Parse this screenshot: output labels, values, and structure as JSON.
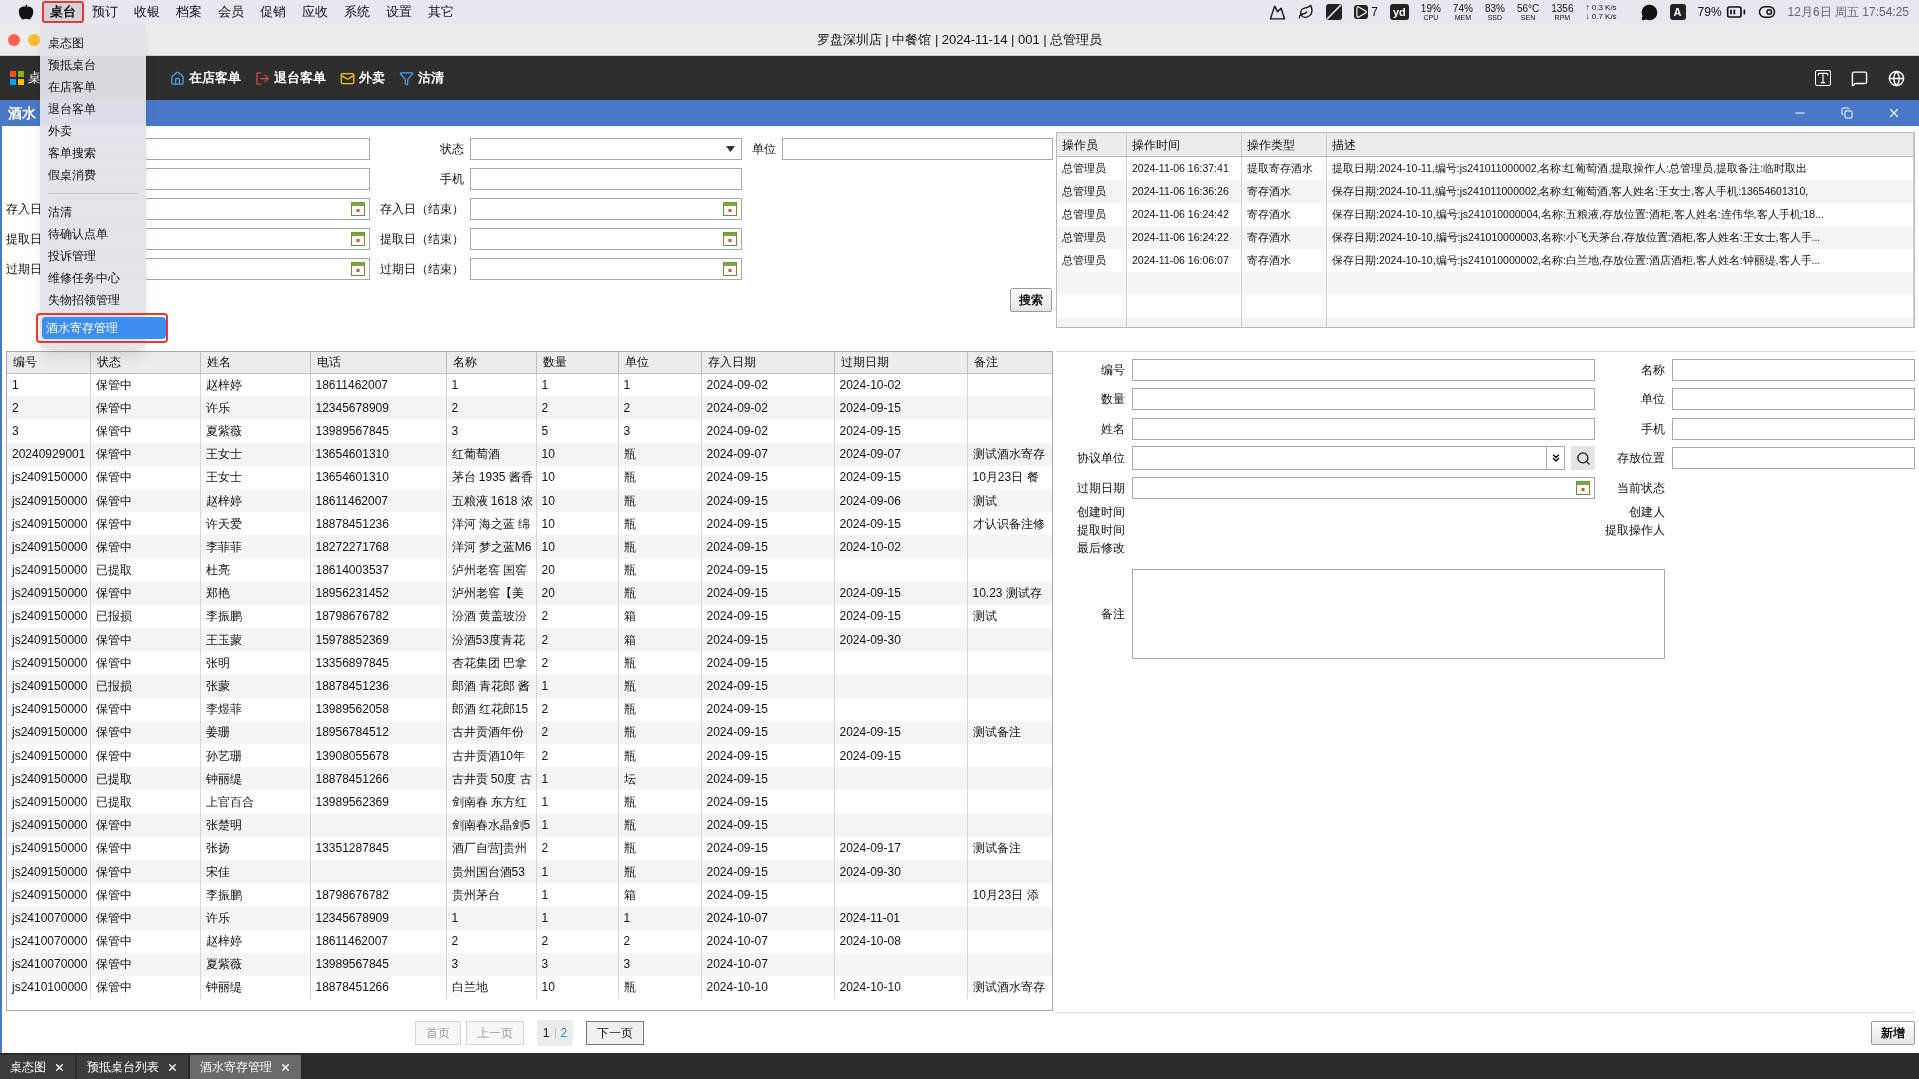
{
  "menubar": {
    "items": [
      {
        "label": "桌台",
        "selected": true,
        "annotated": true
      },
      {
        "label": "预订",
        "selected": false,
        "annotated": false
      },
      {
        "label": "收银",
        "selected": false,
        "annotated": false
      },
      {
        "label": "档案",
        "selected": false,
        "annotated": false
      },
      {
        "label": "会员",
        "selected": false,
        "annotated": false
      },
      {
        "label": "促销",
        "selected": false,
        "annotated": false
      },
      {
        "label": "应收",
        "selected": false,
        "annotated": false
      },
      {
        "label": "系统",
        "selected": false,
        "annotated": false
      },
      {
        "label": "设置",
        "selected": false,
        "annotated": false
      },
      {
        "label": "其它",
        "selected": false,
        "annotated": false
      }
    ],
    "badge_count": "7",
    "yd": "yd",
    "meters": [
      {
        "value": "19%",
        "caption": "CPU"
      },
      {
        "value": "74%",
        "caption": "MEM"
      },
      {
        "value": "83%",
        "caption": "SSD"
      },
      {
        "value": "56°C",
        "caption": "SEN"
      },
      {
        "value": "1356",
        "caption": "RPM"
      }
    ],
    "network": [
      "↑ 0.3 K/s",
      "↓ 0.7 K/s"
    ],
    "input_source": "A",
    "battery": "79%",
    "clock": "12月6日 周五 17:54:25"
  },
  "window": {
    "title": "罗盘深圳店 | 中餐馆 | 2024-11-14 | 001 | 总管理员"
  },
  "toolbar": {
    "home": "桌",
    "items": [
      {
        "label": "在店客单",
        "kind": "checkin"
      },
      {
        "label": "退台客单",
        "kind": "checkout"
      },
      {
        "label": "外卖",
        "kind": "takeout"
      },
      {
        "label": "沽清",
        "kind": "filter"
      }
    ]
  },
  "dropdown": {
    "items": [
      {
        "kind": "item",
        "label": "桌态图",
        "selected": false,
        "annotated": false
      },
      {
        "kind": "item",
        "label": "预抵桌台",
        "selected": false,
        "annotated": false
      },
      {
        "kind": "item",
        "label": "在店客单",
        "selected": false,
        "annotated": false
      },
      {
        "kind": "item",
        "label": "退台客单",
        "selected": false,
        "annotated": false
      },
      {
        "kind": "item",
        "label": "外卖",
        "selected": false,
        "annotated": false
      },
      {
        "kind": "item",
        "label": "客单搜索",
        "selected": false,
        "annotated": false
      },
      {
        "kind": "item",
        "label": "假桌消费",
        "selected": false,
        "annotated": false
      },
      {
        "kind": "separator"
      },
      {
        "kind": "item",
        "label": "沽清",
        "selected": false,
        "annotated": false
      },
      {
        "kind": "item",
        "label": "待确认点单",
        "selected": false,
        "annotated": false
      },
      {
        "kind": "item",
        "label": "投诉管理",
        "selected": false,
        "annotated": false
      },
      {
        "kind": "item",
        "label": "维修任务中心",
        "selected": false,
        "annotated": false
      },
      {
        "kind": "item",
        "label": "失物招领管理",
        "selected": false,
        "annotated": false
      },
      {
        "kind": "item",
        "label": "酒水寄存管理",
        "selected": true,
        "annotated": true
      }
    ]
  },
  "panel": {
    "title": "酒水"
  },
  "filters": [
    {
      "fields": [
        {
          "kind": "text"
        },
        {
          "label": "状态",
          "kind": "select"
        },
        {
          "label": "单位",
          "kind": "text"
        }
      ]
    },
    {
      "fields": [
        {
          "kind": "text"
        },
        {
          "label": "手机",
          "kind": "text"
        }
      ]
    },
    {
      "fields": [
        {
          "label": "存入日",
          "kind": "date"
        },
        {
          "label": "存入日（结束）",
          "kind": "date"
        }
      ]
    },
    {
      "fields": [
        {
          "label": "提取日",
          "kind": "date"
        },
        {
          "label": "提取日（结束）",
          "kind": "date"
        }
      ]
    },
    {
      "fields": [
        {
          "label": "过期日",
          "kind": "date"
        },
        {
          "label": "过期日（结束）",
          "kind": "date"
        }
      ]
    }
  ],
  "search_button": "搜索",
  "log": {
    "columns": [
      "操作员",
      "操作时间",
      "操作类型",
      "描述"
    ],
    "rows": [
      {
        "operator": "总管理员",
        "time": "2024-11-06 16:37:41",
        "type": "提取寄存酒水",
        "description": "提取日期:2024-10-11,编号:js241011000002,名称:红葡萄酒,提取操作人:总管理员,提取备注:临时取出"
      },
      {
        "operator": "总管理员",
        "time": "2024-11-06 16:36:26",
        "type": "寄存酒水",
        "description": "保存日期:2024-10-11,编号:js241011000002,名称:红葡萄酒,客人姓名:王女士,客人手机:13654601310,"
      },
      {
        "operator": "总管理员",
        "time": "2024-11-06 16:24:42",
        "type": "寄存酒水",
        "description": "保存日期:2024-10-10,编号:js241010000004,名称:五粮液,存放位置:酒柜,客人姓名:连伟华,客人手机:18..."
      },
      {
        "operator": "总管理员",
        "time": "2024-11-06 16:24:22",
        "type": "寄存酒水",
        "description": "保存日期:2024-10-10,编号:js241010000003,名称:小飞天茅台,存放位置:酒柜,客人姓名:王女士,客人手..."
      },
      {
        "operator": "总管理员",
        "time": "2024-11-06 16:06:07",
        "type": "寄存酒水",
        "description": "保存日期:2024-10-10,编号:js241010000002,名称:白兰地,存放位置:酒店酒柜,客人姓名:钟丽缇,客人手..."
      }
    ]
  },
  "table": {
    "columns": [
      "编号",
      "状态",
      "姓名",
      "电话",
      "名称",
      "数量",
      "单位",
      "存入日期",
      "过期日期",
      "备注"
    ],
    "rows": [
      {
        "id": "1",
        "status": "保管中",
        "name": "赵梓婷",
        "phone": "18611462007",
        "item": "1",
        "qty": "1",
        "unit": "1",
        "stored": "2024-09-02",
        "expires": "2024-10-02"
      },
      {
        "id": "2",
        "status": "保管中",
        "name": "许乐",
        "phone": "12345678909",
        "item": "2",
        "qty": "2",
        "unit": "2",
        "stored": "2024-09-02",
        "expires": "2024-09-15"
      },
      {
        "id": "3",
        "status": "保管中",
        "name": "夏紫薇",
        "phone": "13989567845",
        "item": "3",
        "qty": "5",
        "unit": "3",
        "stored": "2024-09-02",
        "expires": "2024-09-15"
      },
      {
        "id": "20240929001",
        "status": "保管中",
        "name": "王女士",
        "phone": "13654601310",
        "item": "红葡萄酒",
        "qty": "10",
        "unit": "瓶",
        "stored": "2024-09-07",
        "expires": "2024-09-07",
        "note": "测试酒水寄存"
      },
      {
        "id": "js2409150000",
        "status": "保管中",
        "name": "王女士",
        "phone": "13654601310",
        "item": "茅台 1935 酱香",
        "qty": "10",
        "unit": "瓶",
        "stored": "2024-09-15",
        "expires": "2024-09-15",
        "note": "10月23日 餐"
      },
      {
        "id": "js2409150000",
        "status": "保管中",
        "name": "赵梓婷",
        "phone": "18611462007",
        "item": "五粮液 1618 浓",
        "qty": "10",
        "unit": "瓶",
        "stored": "2024-09-15",
        "expires": "2024-09-06",
        "note": "测试"
      },
      {
        "id": "js2409150000",
        "status": "保管中",
        "name": "许天爱",
        "phone": "18878451236",
        "item": "洋河 海之蓝 绵",
        "qty": "10",
        "unit": "瓶",
        "stored": "2024-09-15",
        "expires": "2024-09-15",
        "note": "才认识备注修"
      },
      {
        "id": "js2409150000",
        "status": "保管中",
        "name": "李菲菲",
        "phone": "18272271768",
        "item": "洋河 梦之蓝M6",
        "qty": "10",
        "unit": "瓶",
        "stored": "2024-09-15",
        "expires": "2024-10-02"
      },
      {
        "id": "js2409150000",
        "status": "已提取",
        "name": "杜亮",
        "phone": "18614003537",
        "item": "泸州老窖 国窖",
        "qty": "20",
        "unit": "瓶",
        "stored": "2024-09-15"
      },
      {
        "id": "js2409150000",
        "status": "保管中",
        "name": "郑艳",
        "phone": "18956231452",
        "item": "泸州老窖【美",
        "qty": "20",
        "unit": "瓶",
        "stored": "2024-09-15",
        "expires": "2024-09-15",
        "note": "10.23 测试存"
      },
      {
        "id": "js2409150000",
        "status": "已报损",
        "name": "李振鹏",
        "phone": "18798676782",
        "item": "汾酒 黄盖玻汾",
        "qty": "2",
        "unit": "箱",
        "stored": "2024-09-15",
        "expires": "2024-09-15",
        "note": "测试"
      },
      {
        "id": "js2409150000",
        "status": "保管中",
        "name": "王玉蒙",
        "phone": "15978852369",
        "item": "汾酒53度青花",
        "qty": "2",
        "unit": "箱",
        "stored": "2024-09-15",
        "expires": "2024-09-30"
      },
      {
        "id": "js2409150000",
        "status": "保管中",
        "name": "张明",
        "phone": "13356897845",
        "item": "杏花集团 巴拿",
        "qty": "2",
        "unit": "瓶",
        "stored": "2024-09-15"
      },
      {
        "id": "js2409150000",
        "status": "已报损",
        "name": "张蒙",
        "phone": "18878451236",
        "item": "郎酒 青花郎 酱",
        "qty": "1",
        "unit": "瓶",
        "stored": "2024-09-15"
      },
      {
        "id": "js2409150000",
        "status": "保管中",
        "name": "李煜菲",
        "phone": "13989562058",
        "item": "郎酒 红花郎15",
        "qty": "2",
        "unit": "瓶",
        "stored": "2024-09-15"
      },
      {
        "id": "js2409150000",
        "status": "保管中",
        "name": "姜珊",
        "phone": "18956784512",
        "item": "古井贡酒年份",
        "qty": "2",
        "unit": "瓶",
        "stored": "2024-09-15",
        "expires": "2024-09-15",
        "note": "测试备注"
      },
      {
        "id": "js2409150000",
        "status": "保管中",
        "name": "孙艺珊",
        "phone": "13908055678",
        "item": "古井贡酒10年",
        "qty": "2",
        "unit": "瓶",
        "stored": "2024-09-15",
        "expires": "2024-09-15"
      },
      {
        "id": "js2409150000",
        "status": "已提取",
        "name": "钟丽缇",
        "phone": "18878451266",
        "item": "古井贡 50度 古",
        "qty": "1",
        "unit": "坛",
        "stored": "2024-09-15"
      },
      {
        "id": "js2409150000",
        "status": "已提取",
        "name": "上官百合",
        "phone": "13989562369",
        "item": "剑南春 东方红",
        "qty": "1",
        "unit": "瓶",
        "stored": "2024-09-15"
      },
      {
        "id": "js2409150000",
        "status": "保管中",
        "name": "张楚明",
        "item": "剑南春水晶剑5",
        "qty": "1",
        "unit": "瓶",
        "stored": "2024-09-15"
      },
      {
        "id": "js2409150000",
        "status": "保管中",
        "name": "张扬",
        "phone": "13351287845",
        "item": "酒厂自营]贵州",
        "qty": "2",
        "unit": "瓶",
        "stored": "2024-09-15",
        "expires": "2024-09-17",
        "note": "测试备注"
      },
      {
        "id": "js2409150000",
        "status": "保管中",
        "name": "宋佳",
        "item": "贵州国台酒53",
        "qty": "1",
        "unit": "瓶",
        "stored": "2024-09-15",
        "expires": "2024-09-30"
      },
      {
        "id": "js2409150000",
        "status": "保管中",
        "name": "李振鹏",
        "phone": "18798676782",
        "item": "贵州茅台",
        "qty": "1",
        "unit": "箱",
        "stored": "2024-09-15",
        "note": "10月23日 添"
      },
      {
        "id": "js2410070000",
        "status": "保管中",
        "name": "许乐",
        "phone": "12345678909",
        "item": "1",
        "qty": "1",
        "unit": "1",
        "stored": "2024-10-07",
        "expires": "2024-11-01"
      },
      {
        "id": "js2410070000",
        "status": "保管中",
        "name": "赵梓婷",
        "phone": "18611462007",
        "item": "2",
        "qty": "2",
        "unit": "2",
        "stored": "2024-10-07",
        "expires": "2024-10-08"
      },
      {
        "id": "js2410070000",
        "status": "保管中",
        "name": "夏紫薇",
        "phone": "13989567845",
        "item": "3",
        "qty": "3",
        "unit": "3",
        "stored": "2024-10-07"
      },
      {
        "id": "js2410100000",
        "status": "保管中",
        "name": "钟丽缇",
        "phone": "18878451266",
        "item": "白兰地",
        "qty": "10",
        "unit": "瓶",
        "stored": "2024-10-10",
        "expires": "2024-10-10",
        "note": "测试酒水寄存"
      }
    ]
  },
  "pagination": {
    "first": {
      "label": "首页",
      "disabled": true
    },
    "prev": {
      "label": "上一页",
      "disabled": true
    },
    "pages": [
      {
        "label": "1",
        "selected": true
      },
      {
        "label": "2",
        "selected": false
      }
    ],
    "next": {
      "label": "下一页",
      "disabled": false
    }
  },
  "detail": {
    "left": [
      {
        "label": "编号",
        "kind": "text"
      },
      {
        "label": "数量",
        "kind": "text"
      },
      {
        "label": "姓名",
        "kind": "text"
      },
      {
        "label": "协议单位",
        "kind": "lookup"
      },
      {
        "label": "过期日期",
        "kind": "date"
      },
      {
        "label": "创建时间",
        "kind": "info"
      },
      {
        "label": "提取时间",
        "kind": "info"
      },
      {
        "label": "最后修改",
        "kind": "info"
      }
    ],
    "right": [
      {
        "label": "名称",
        "kind": "text"
      },
      {
        "label": "单位",
        "kind": "text"
      },
      {
        "label": "手机",
        "kind": "text"
      },
      {
        "label": "存放位置",
        "kind": "text"
      },
      {
        "label": "当前状态",
        "kind": "info"
      },
      {
        "label": "创建人",
        "kind": "info"
      },
      {
        "label": "提取操作人",
        "kind": "info"
      }
    ],
    "remarks_label": "备注",
    "add_button": "新增"
  },
  "tabs": [
    {
      "label": "桌态图",
      "selected": false
    },
    {
      "label": "预抵桌台列表",
      "selected": false
    },
    {
      "label": "酒水寄存管理",
      "selected": true
    }
  ]
}
